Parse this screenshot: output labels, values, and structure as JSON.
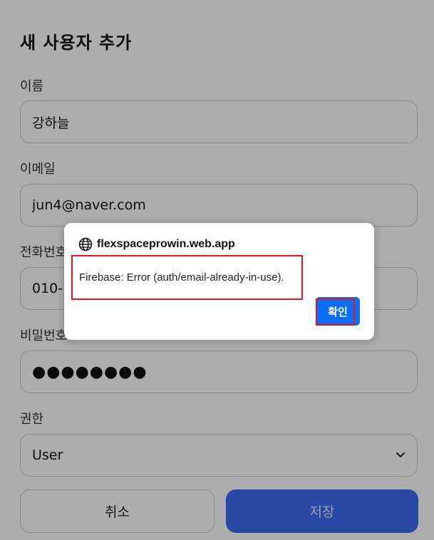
{
  "form": {
    "title": "새 사용자 추가",
    "name_label": "이름",
    "name_value": "강하늘",
    "email_label": "이메일",
    "email_value": "jun4@naver.com",
    "phone_label": "전화번호",
    "phone_value": "010-1",
    "password_label": "비밀번호",
    "password_value": "●●●●●●●●",
    "role_label": "권한",
    "role_value": "User",
    "cancel_label": "취소",
    "save_label": "저장"
  },
  "dialog": {
    "origin": "flexspaceprowin.web.app",
    "message": "Firebase: Error (auth/email-already-in-use).",
    "ok_label": "확인",
    "origin_icon": "globe-icon"
  },
  "colors": {
    "save_button": "#3b6ef5",
    "ok_button": "#0b6cf5",
    "annotation_outline": "#e0141c",
    "overlay": "rgba(0,0,0,0.32)"
  }
}
